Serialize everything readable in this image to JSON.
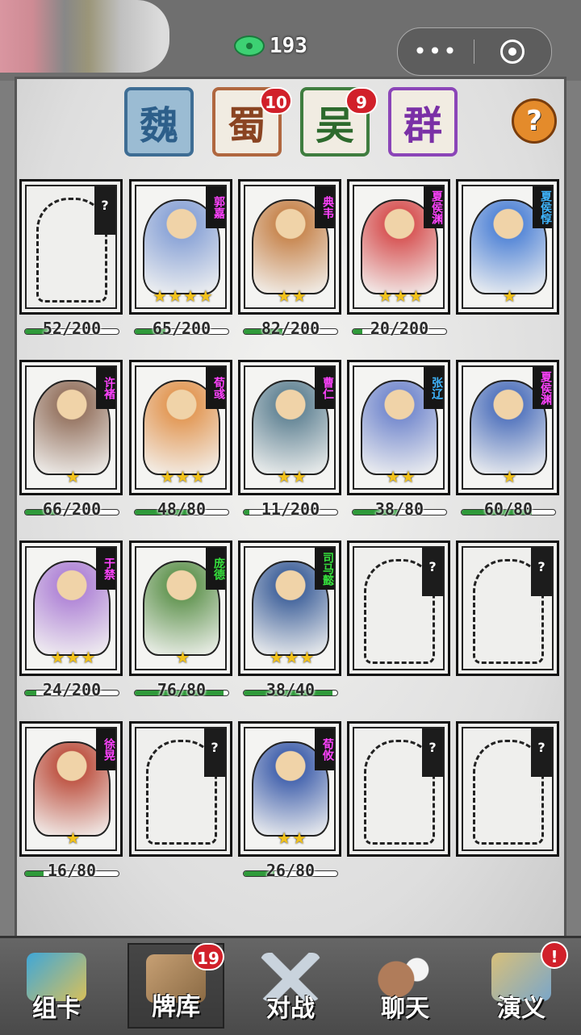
{
  "header": {
    "currency_value": "193",
    "currency_icon": "jade-coin-icon",
    "more_label": "•••"
  },
  "factions": [
    {
      "label": "魏",
      "badge": null
    },
    {
      "label": "蜀",
      "badge": "10"
    },
    {
      "label": "吴",
      "badge": "9"
    },
    {
      "label": "群",
      "badge": null
    }
  ],
  "help_label": "?",
  "cards": [
    {
      "name": "",
      "locked": true,
      "stars": 0,
      "progress": "52/200",
      "fill": 0.26
    },
    {
      "name": "郭嘉",
      "locked": false,
      "stars": 4,
      "progress": "65/200",
      "fill": 0.33,
      "color": "#8fa7d8"
    },
    {
      "name": "典韦",
      "locked": false,
      "stars": 2,
      "progress": "82/200",
      "fill": 0.41,
      "color": "#c98a55"
    },
    {
      "name": "夏侯渊",
      "locked": false,
      "stars": 3,
      "progress": "20/200",
      "fill": 0.1,
      "color": "#d85a5a"
    },
    {
      "name": "夏侯惇",
      "locked": false,
      "stars": 1,
      "progress": "",
      "fill": 0,
      "color": "#5a8ad8"
    },
    {
      "name": "许褚",
      "locked": false,
      "stars": 1,
      "progress": "66/200",
      "fill": 0.33,
      "color": "#9a7a68"
    },
    {
      "name": "荀彧",
      "locked": false,
      "stars": 3,
      "progress": "48/80",
      "fill": 0.6,
      "color": "#e39c5c"
    },
    {
      "name": "曹仁",
      "locked": false,
      "stars": 2,
      "progress": "11/200",
      "fill": 0.06,
      "color": "#6a8a9a"
    },
    {
      "name": "张辽",
      "locked": false,
      "stars": 2,
      "progress": "38/80",
      "fill": 0.48,
      "color": "#7b8fd0"
    },
    {
      "name": "夏侯渊",
      "locked": false,
      "stars": 1,
      "progress": "60/80",
      "fill": 0.75,
      "color": "#5a7ac0"
    },
    {
      "name": "于禁",
      "locked": false,
      "stars": 3,
      "progress": "24/200",
      "fill": 0.12,
      "color": "#b38ad8"
    },
    {
      "name": "庞德",
      "locked": false,
      "stars": 1,
      "progress": "76/80",
      "fill": 0.95,
      "color": "#6a9a5a"
    },
    {
      "name": "司马懿",
      "locked": false,
      "stars": 3,
      "progress": "38/40",
      "fill": 0.95,
      "color": "#4a6aa0"
    },
    {
      "name": "",
      "locked": true,
      "stars": 0,
      "progress": "",
      "fill": 0
    },
    {
      "name": "",
      "locked": true,
      "stars": 0,
      "progress": "",
      "fill": 0
    },
    {
      "name": "徐晃",
      "locked": false,
      "stars": 1,
      "progress": "16/80",
      "fill": 0.2,
      "color": "#c05a4a"
    },
    {
      "name": "",
      "locked": true,
      "stars": 0,
      "progress": "",
      "fill": 0
    },
    {
      "name": "荀攸",
      "locked": false,
      "stars": 2,
      "progress": "26/80",
      "fill": 0.33,
      "color": "#4a68b0"
    },
    {
      "name": "",
      "locked": true,
      "stars": 0,
      "progress": "",
      "fill": 0
    },
    {
      "name": "",
      "locked": true,
      "stars": 0,
      "progress": "",
      "fill": 0
    }
  ],
  "nav": [
    {
      "label": "组卡",
      "icon": "cards-icon",
      "badge": null
    },
    {
      "label": "牌库",
      "icon": "card-library-icon",
      "badge": "19"
    },
    {
      "label": "对战",
      "icon": "crossed-swords-icon",
      "badge": null
    },
    {
      "label": "聊天",
      "icon": "chat-icon",
      "badge": null
    },
    {
      "label": "演义",
      "icon": "scroll-icon",
      "badge": "!"
    }
  ]
}
